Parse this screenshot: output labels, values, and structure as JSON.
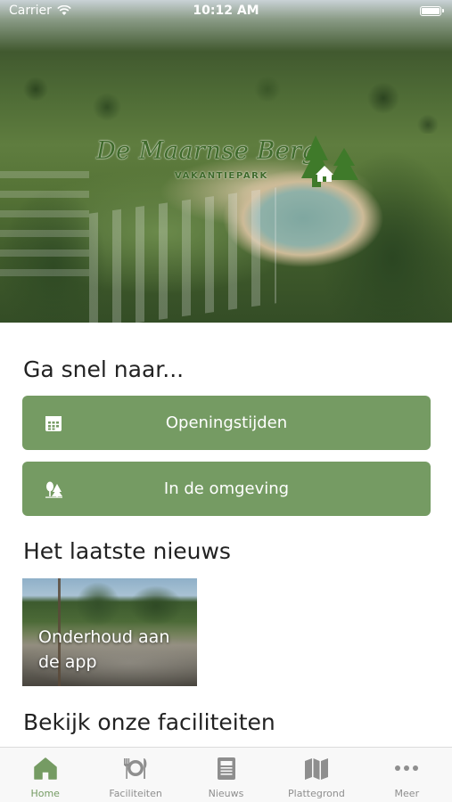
{
  "status_bar": {
    "carrier": "Carrier",
    "time": "10:12 AM",
    "battery": "full"
  },
  "hero": {
    "logo_script": "De Maarnse Berg",
    "logo_subtitle": "VAKANTIEPARK"
  },
  "quick_links": {
    "title": "Ga snel naar...",
    "items": [
      {
        "label": "Openingstijden",
        "icon": "calendar-icon"
      },
      {
        "label": "In de omgeving",
        "icon": "trees-icon"
      }
    ]
  },
  "news": {
    "title": "Het laatste nieuws",
    "items": [
      {
        "title": "Onderhoud aan de app"
      }
    ]
  },
  "facilities": {
    "title": "Bekijk onze faciliteiten"
  },
  "tab_bar": {
    "active": "Home",
    "tabs": [
      {
        "label": "Home",
        "icon": "home-icon"
      },
      {
        "label": "Faciliteiten",
        "icon": "dining-icon"
      },
      {
        "label": "Nieuws",
        "icon": "newspaper-icon"
      },
      {
        "label": "Plattegrond",
        "icon": "map-icon"
      },
      {
        "label": "Meer",
        "icon": "more-icon"
      }
    ]
  },
  "colors": {
    "accent": "#759b63",
    "tab_inactive": "#8e8e8e",
    "logo_green": "#3f6a2b"
  }
}
